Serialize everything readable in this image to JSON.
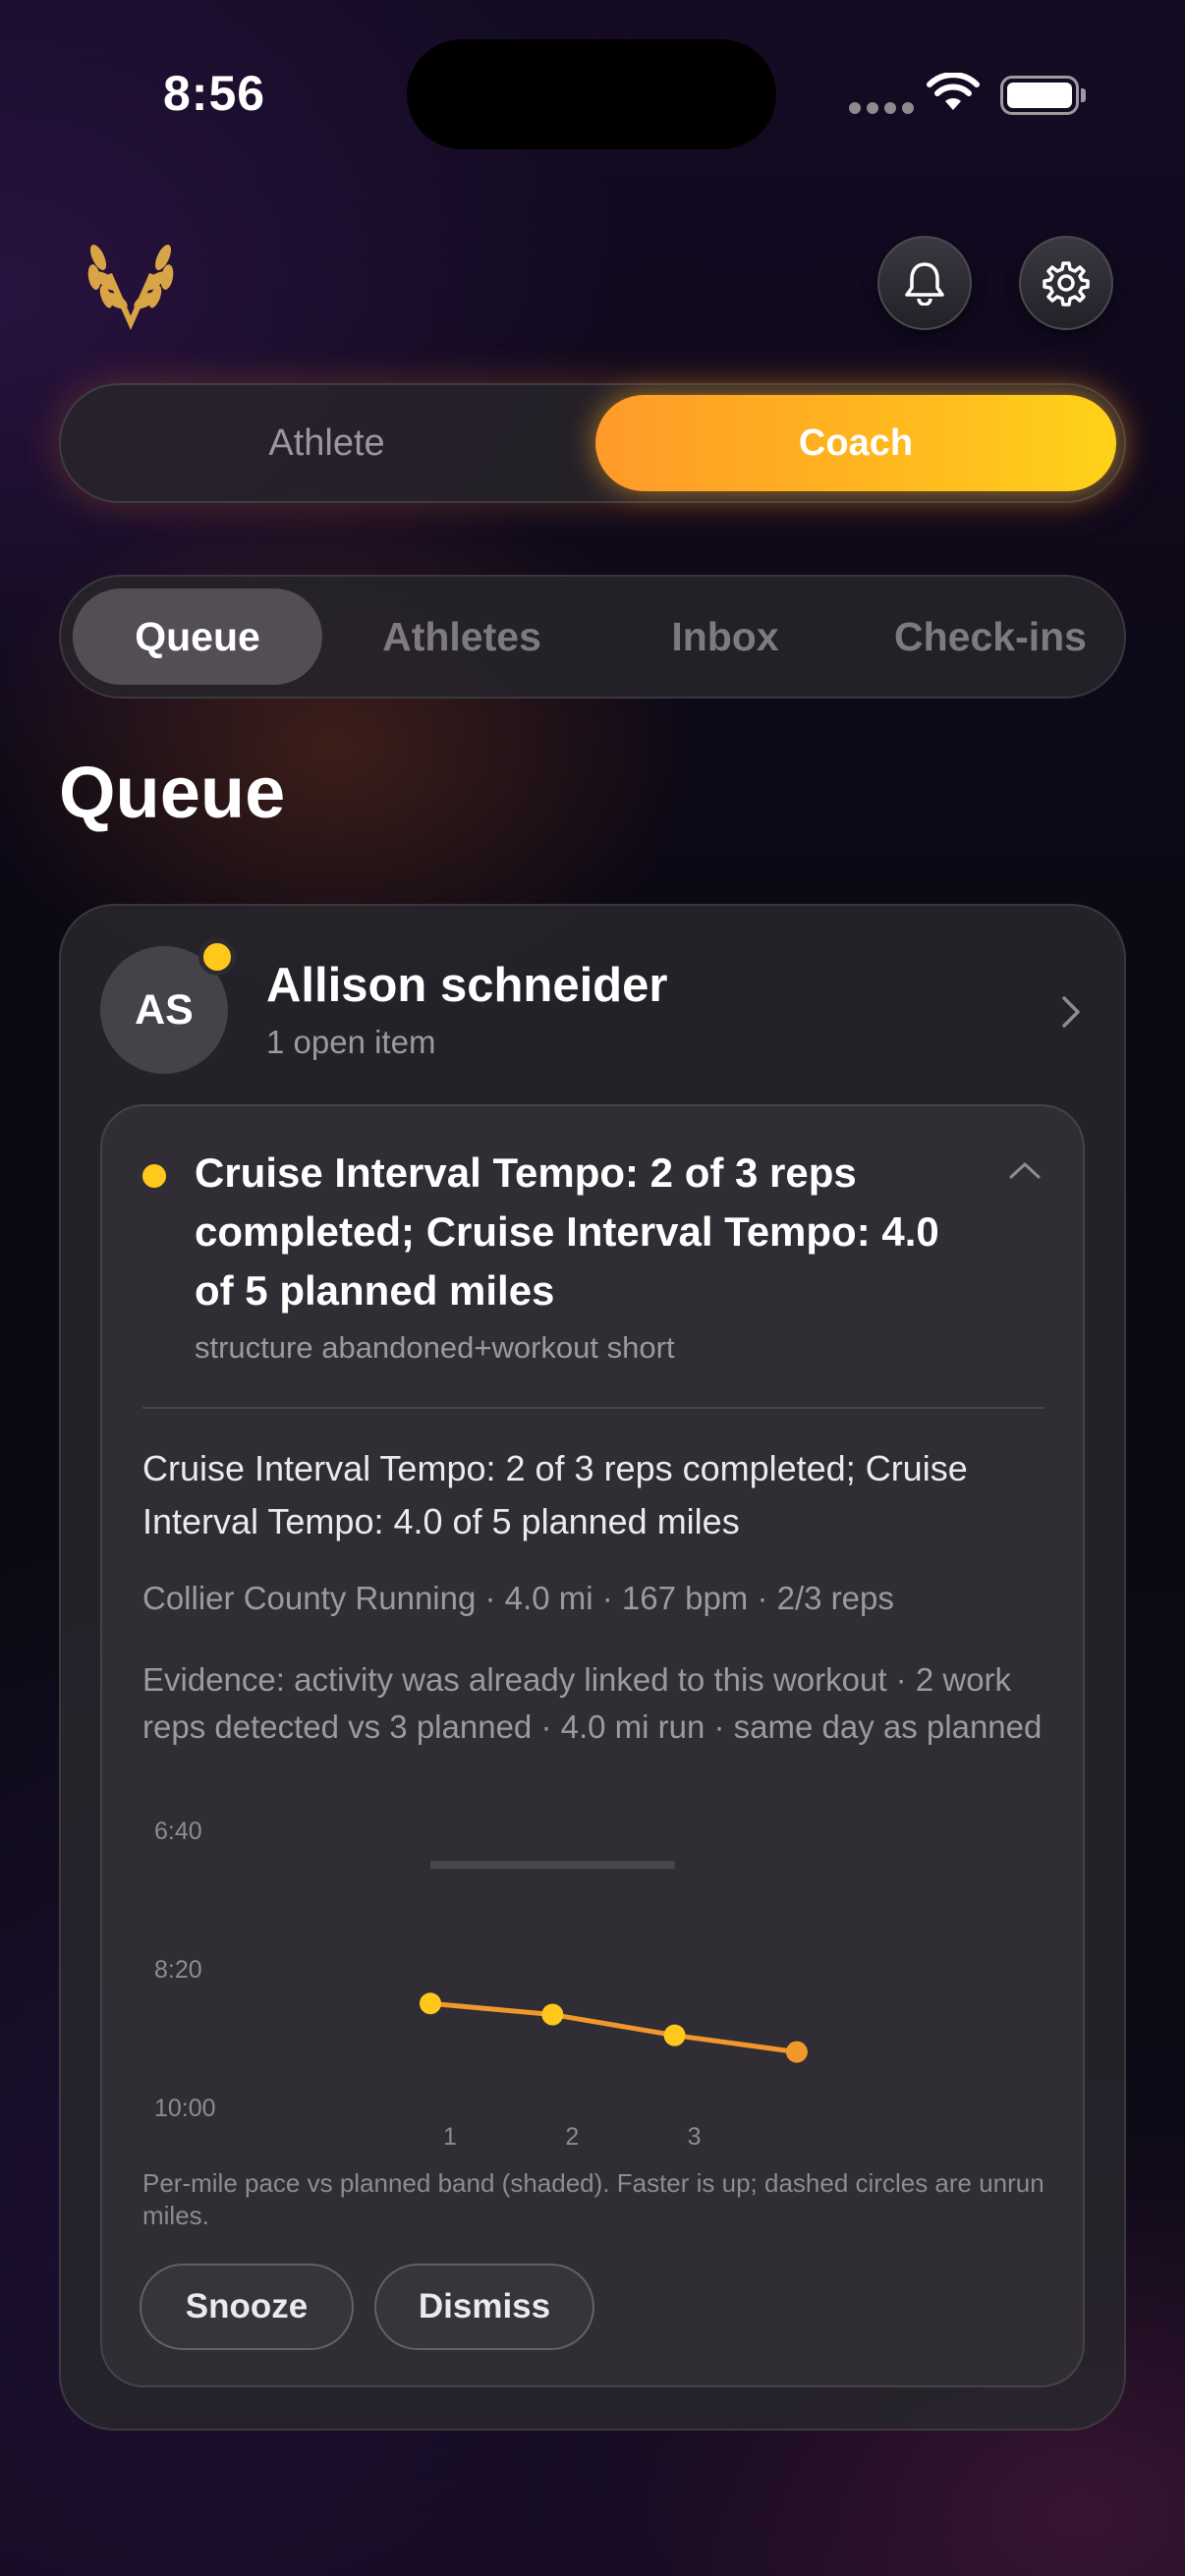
{
  "status_bar": {
    "time": "8:56"
  },
  "header": {
    "logo": "laurel-v-logo",
    "notifications_icon": "bell-icon",
    "settings_icon": "gear-icon"
  },
  "mode_toggle": {
    "options": [
      "Athlete",
      "Coach"
    ],
    "selected": "Coach"
  },
  "tabs": {
    "items": [
      "Queue",
      "Athletes",
      "Inbox",
      "Check-ins"
    ],
    "active": "Queue"
  },
  "page": {
    "title": "Queue"
  },
  "queue_card": {
    "avatar_initials": "AS",
    "athlete_name": "Allison schneider",
    "open_items": "1 open item",
    "item": {
      "title": "Cruise Interval Tempo: 2 of 3 reps completed; Cruise Interval Tempo: 4.0 of 5 planned miles",
      "subtitle": "structure abandoned+workout short",
      "summary": "Cruise Interval Tempo: 2 of 3 reps completed; Cruise Interval Tempo: 4.0 of 5 planned miles",
      "meta": "Collier County Running · 4.0 mi · 167 bpm · 2/3 reps",
      "evidence": "Evidence: activity was already linked to this workout · 2 work reps detected vs 3 planned · 4.0 mi run · same day as planned",
      "chart_caption": "Per-mile pace vs planned band (shaded). Faster is up; dashed circles are unrun miles.",
      "actions": {
        "snooze": "Snooze",
        "dismiss": "Dismiss"
      }
    }
  },
  "chart_data": {
    "type": "line",
    "title": "",
    "xlabel": "",
    "ylabel": "",
    "y_tick_labels": [
      "6:40",
      "8:20",
      "10:00"
    ],
    "x_tick_labels": [
      "1",
      "2",
      "3"
    ],
    "y_inverted": true,
    "ylim_seconds_per_mile": [
      400,
      600
    ],
    "planned_band_seconds_per_mile": {
      "x_start": 1,
      "x_end": 3,
      "pace": 425
    },
    "series": [
      {
        "x": [
          1,
          2,
          3,
          4
        ],
        "pace_seconds_per_mile": [
          525,
          533,
          548,
          560
        ]
      }
    ],
    "colors": {
      "line": "#f0992a",
      "points": [
        "#ffc81a",
        "#ffc81a",
        "#ffc81a",
        "#f0992a"
      ],
      "band": "#4a474e"
    }
  }
}
